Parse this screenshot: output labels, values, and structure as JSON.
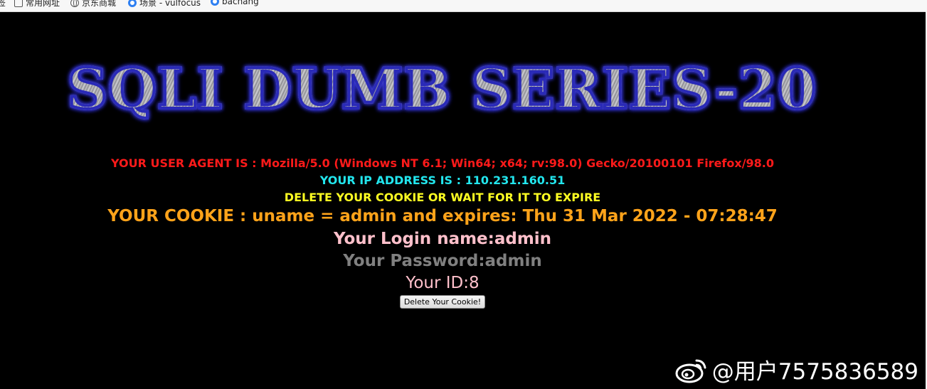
{
  "bookmarks": [
    {
      "name": "bookmark-folder-common",
      "icon": "folder-icon",
      "label": "常用网址"
    },
    {
      "name": "bookmark-jd",
      "icon": "globe-icon",
      "label": "京东商城"
    },
    {
      "name": "bookmark-vulfocus",
      "icon": "site-icon",
      "label": "场景 - vulfocus"
    },
    {
      "name": "bookmark-bachang",
      "icon": "site-icon",
      "label": "bachang"
    }
  ],
  "bookmark_leading_fragment": "签",
  "banner": {
    "title": "SQLI DUMB SERIES-20"
  },
  "info": {
    "user_agent": "YOUR USER AGENT IS : Mozilla/5.0 (Windows NT 6.1; Win64; x64; rv:98.0) Gecko/20100101 Firefox/98.0",
    "ip": "YOUR IP ADDRESS IS : 110.231.160.51",
    "delete_notice": "DELETE YOUR COOKIE OR WAIT FOR IT TO EXPIRE",
    "cookie": "YOUR COOKIE : uname = admin and expires: Thu 31 Mar 2022 - 07:28:47",
    "login_name": "Your Login name:admin",
    "password": "Your Password:admin",
    "id": "Your ID:8"
  },
  "delete_button": {
    "label": "Delete Your Cookie!"
  },
  "watermark": {
    "text": "@用户7575836589",
    "icon": "weibo-icon"
  },
  "colors": {
    "background": "#000000",
    "user_agent": "#ff1a1a",
    "ip": "#22e6ee",
    "delete_notice": "#ffff22",
    "cookie": "#ffa31a",
    "login_name": "#ffc0cb",
    "password": "#808080",
    "id": "#ffc0cb",
    "banner_outline": "#2a2ab8"
  }
}
